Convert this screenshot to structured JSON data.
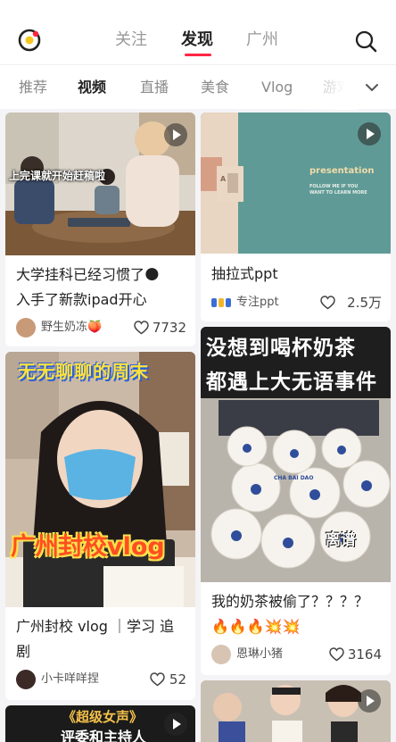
{
  "header": {
    "tabs": [
      {
        "label": "关注"
      },
      {
        "label": "发现"
      },
      {
        "label": "广州"
      }
    ]
  },
  "categories": [
    {
      "label": "推荐"
    },
    {
      "label": "视频"
    },
    {
      "label": "直播"
    },
    {
      "label": "美食"
    },
    {
      "label": "Vlog"
    },
    {
      "label": "游戏"
    }
  ],
  "feed": [
    {
      "overlay": "上完课就开始赶稿啦",
      "title_line1": "大学挂科已经习惯了🌑",
      "title_line2": "入手了新款ipad开心",
      "author": "野生奶冻🍑",
      "likes": "7732"
    },
    {
      "thumb_title": "presentation",
      "thumb_sub1": "FOLLOW ME IF YOU",
      "thumb_sub2": "WANT TO LEARN MORE",
      "tag_a": "A",
      "title_line1": "抽拉式ppt",
      "author": "专注ppt",
      "likes": "2.5万"
    },
    {
      "overlay_top": "无无聊聊的周末",
      "overlay_big": "广州封校vlog",
      "title_line1": "广州封校 vlog ｜学习 追",
      "title_line2": "剧",
      "author": "小卡咩咩捏",
      "likes": "52"
    },
    {
      "overlay_line1": "没想到喝杯奶茶",
      "overlay_line2": "都遇上大无语事件",
      "overlay_small": "离谱",
      "cup_brand": "CHA BAI DAO",
      "title_line1": "我的奶茶被偷了？？？？",
      "title_line2": "🔥🔥🔥💥💥",
      "author": "恩琳小猪",
      "likes": "3164"
    },
    {
      "overlay_line1": "《超级女声》",
      "overlay_line2": "评委和主持人"
    },
    {}
  ],
  "colors": {
    "accent": "#ff2442",
    "ppt_teal": "#5f9a96"
  }
}
